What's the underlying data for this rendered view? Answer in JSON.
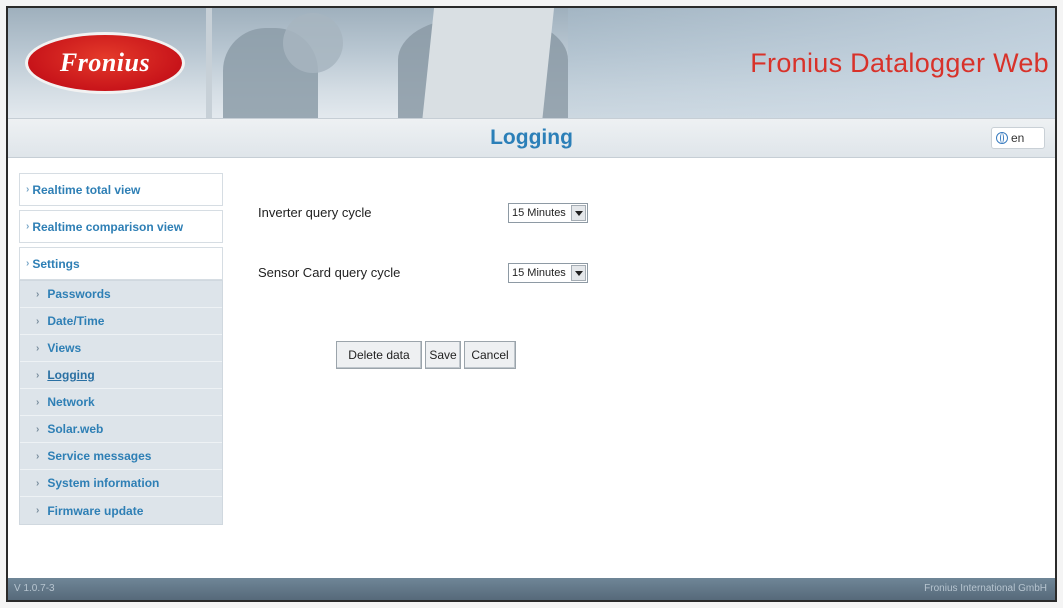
{
  "header": {
    "logo_text": "Fronius",
    "app_title": "Fronius Datalogger Web"
  },
  "titlebar": {
    "page_title": "Logging",
    "language": "en"
  },
  "sidebar": {
    "top_items": [
      {
        "label": "Realtime total view"
      },
      {
        "label": "Realtime comparison view"
      },
      {
        "label": "Settings"
      }
    ],
    "sub_items": [
      {
        "label": "Passwords"
      },
      {
        "label": "Date/Time"
      },
      {
        "label": "Views"
      },
      {
        "label": "Logging"
      },
      {
        "label": "Network"
      },
      {
        "label": "Solar.web"
      },
      {
        "label": "Service messages"
      },
      {
        "label": "System information"
      },
      {
        "label": "Firmware update"
      }
    ]
  },
  "form": {
    "inverter_label": "Inverter query cycle",
    "inverter_value": "15 Minutes",
    "sensor_label": "Sensor Card query cycle",
    "sensor_value": "15 Minutes"
  },
  "buttons": {
    "delete": "Delete data",
    "save": "Save",
    "cancel": "Cancel"
  },
  "footer": {
    "version": "V 1.0.7-3",
    "copyright": "Fronius International GmbH"
  }
}
